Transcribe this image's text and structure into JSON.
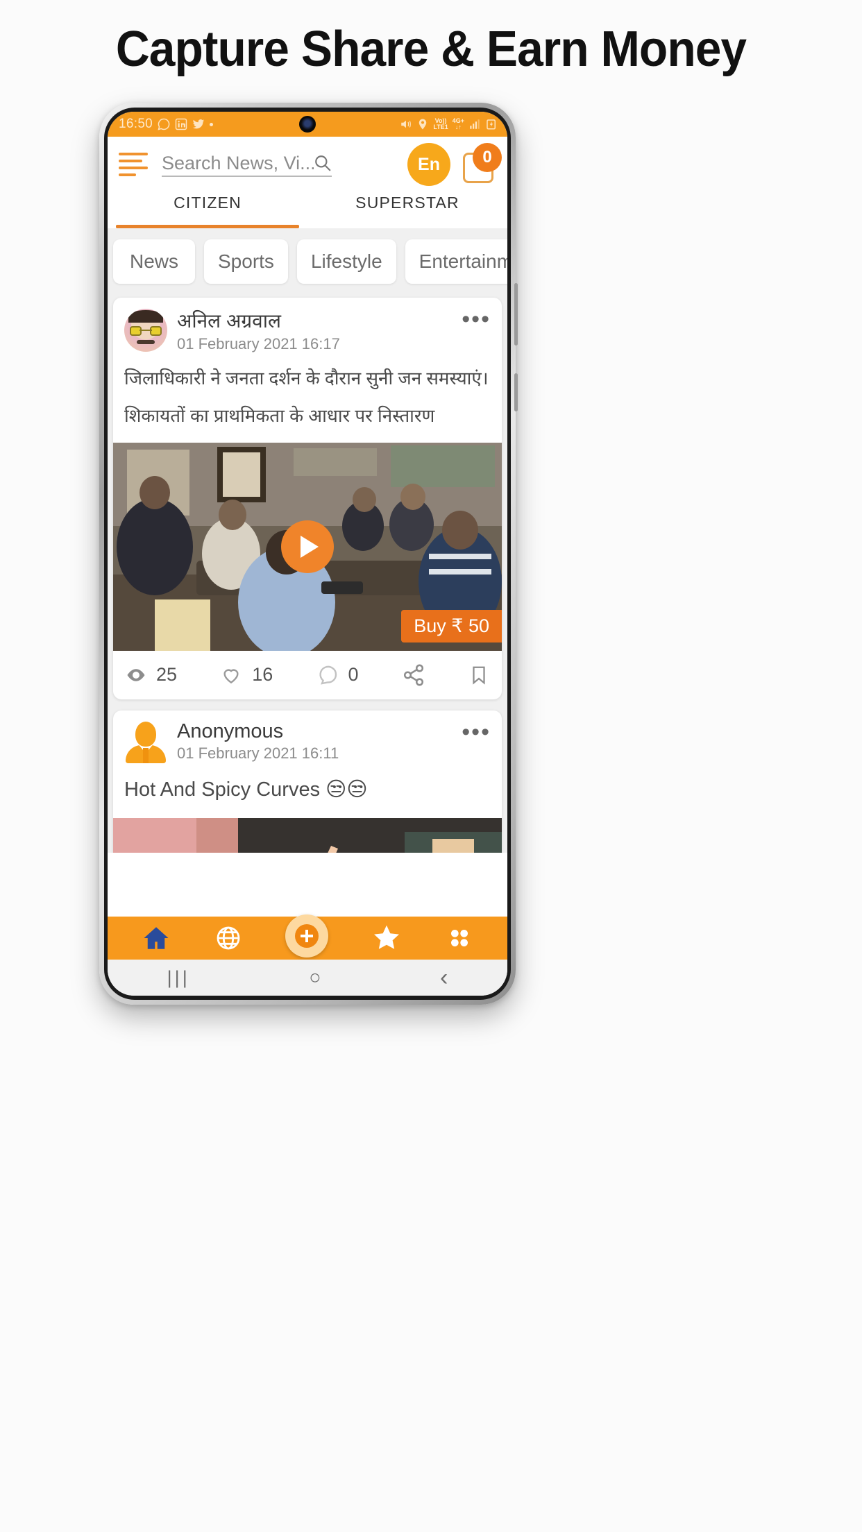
{
  "headline": "Capture Share & Earn Money",
  "statusbar": {
    "time": "16:50",
    "left_icons": [
      "whatsapp-icon",
      "linkedin-icon",
      "twitter-icon",
      "dot-icon"
    ],
    "right_icons": [
      "mute-vibrate-icon",
      "location-icon",
      "volte-icon",
      "network-icon",
      "signal-icon",
      "battery-icon"
    ],
    "volte_line1": "Vo))",
    "volte_line2": "LTE1",
    "network_line1": "4G+",
    "network_line2": "↓↑"
  },
  "appbar": {
    "menu_icon": "hamburger-icon",
    "search_placeholder": "Search News, Vi...",
    "search_icon": "search-icon",
    "language_label": "En",
    "cart_icon": "cart-icon",
    "cart_count": "0"
  },
  "tabs": [
    {
      "label": "CITIZEN",
      "active": true
    },
    {
      "label": "SUPERSTAR",
      "active": false
    }
  ],
  "categories": [
    "News",
    "Sports",
    "Lifestyle",
    "Entertainme"
  ],
  "posts": [
    {
      "author": "अनिल अग्रवाल",
      "date": "01 February 2021 16:17",
      "menu_icon": "more-options-icon",
      "body_lines": [
        "जिलाधिकारी ने जनता दर्शन के दौरान सुनी जन समस्याएं।",
        "शिकायतों का प्राथमिकता के आधार पर निस्तारण"
      ],
      "media_type": "video",
      "play_icon": "play-icon",
      "buy_label": "Buy ₹ 50",
      "stats": {
        "views_icon": "eye-icon",
        "views": "25",
        "likes_icon": "heart-icon",
        "likes": "16",
        "comments_icon": "comment-icon",
        "comments": "0",
        "share_icon": "share-icon",
        "bookmark_icon": "bookmark-icon"
      }
    },
    {
      "author": "Anonymous",
      "date": "01 February 2021 16:11",
      "menu_icon": "more-options-icon",
      "body_lines": [
        "Hot And Spicy Curves 😒😒"
      ],
      "media_type": "image"
    }
  ],
  "bottomnav": [
    {
      "icon": "home-icon",
      "active": true
    },
    {
      "icon": "globe-icon",
      "active": false
    },
    {
      "icon": "add-post-icon",
      "active": false
    },
    {
      "icon": "star-icon",
      "active": false
    },
    {
      "icon": "grid-menu-icon",
      "active": false
    }
  ],
  "androidnav": [
    {
      "icon": "recents-icon",
      "glyph": "|||"
    },
    {
      "icon": "home-icon",
      "glyph": "○"
    },
    {
      "icon": "back-icon",
      "glyph": "‹"
    }
  ],
  "colors": {
    "accent": "#F7991D",
    "accent_dark": "#E8701B",
    "statusbar": "#F59B1E",
    "feed_bg": "#f0f0f0"
  }
}
